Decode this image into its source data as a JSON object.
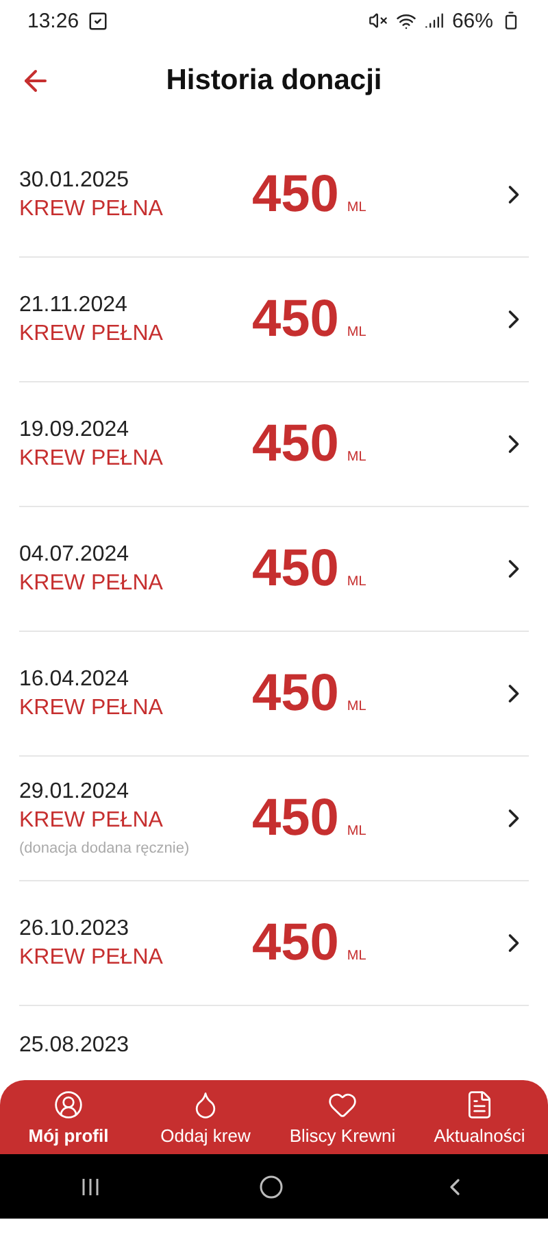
{
  "status_bar": {
    "time": "13:26",
    "battery": "66%"
  },
  "header": {
    "title": "Historia donacji"
  },
  "donations": [
    {
      "date": "30.01.2025",
      "type": "KREW PEŁNA",
      "amount": "450",
      "unit": "ML"
    },
    {
      "date": "21.11.2024",
      "type": "KREW PEŁNA",
      "amount": "450",
      "unit": "ML"
    },
    {
      "date": "19.09.2024",
      "type": "KREW PEŁNA",
      "amount": "450",
      "unit": "ML"
    },
    {
      "date": "04.07.2024",
      "type": "KREW PEŁNA",
      "amount": "450",
      "unit": "ML"
    },
    {
      "date": "16.04.2024",
      "type": "KREW PEŁNA",
      "amount": "450",
      "unit": "ML"
    },
    {
      "date": "29.01.2024",
      "type": "KREW PEŁNA",
      "amount": "450",
      "unit": "ML",
      "note": "(donacja dodana ręcznie)"
    },
    {
      "date": "26.10.2023",
      "type": "KREW PEŁNA",
      "amount": "450",
      "unit": "ML"
    },
    {
      "date": "25.08.2023"
    }
  ],
  "bottom_nav": [
    {
      "label": "Mój profil",
      "selected": true
    },
    {
      "label": "Oddaj krew",
      "selected": false
    },
    {
      "label": "Bliscy Krewni",
      "selected": false
    },
    {
      "label": "Aktualności",
      "selected": false
    }
  ]
}
